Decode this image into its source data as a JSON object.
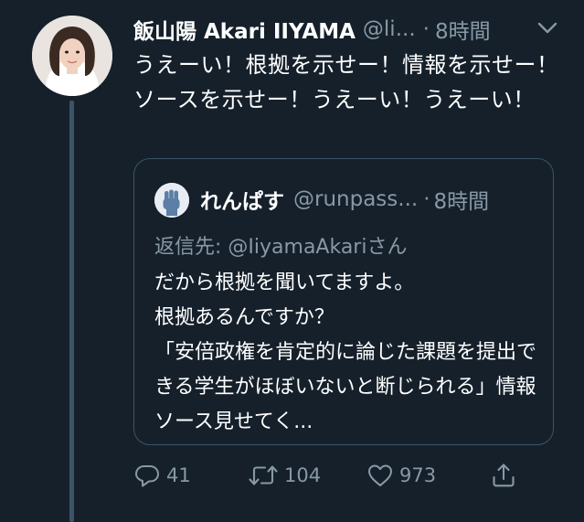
{
  "tweet": {
    "display_name": "飯山陽 Akari IIYAMA",
    "handle": "@li...",
    "separator": "·",
    "time": "8時間",
    "text": "うえーい！根拠を示せー！情報を示せー！ソースを示せー！うえーい！うえーい！",
    "icons": {
      "avatar": "avatar",
      "more": "chevron-down-icon"
    }
  },
  "quoted_tweet": {
    "display_name": "れんぱす",
    "handle": "@runpass...",
    "separator": "·",
    "time": "8時間",
    "reply_prefix": "返信先: ",
    "reply_handle": "@IiyamaAkari",
    "reply_suffix": "さん",
    "text": "だから根拠を聞いてますよ。\n根拠あるんですか？\n「安倍政権を肯定的に論じた課題を提出できる学生がほぼいないと断じられる」情報ソース見せてく..."
  },
  "actions": {
    "reply_count": "41",
    "retweet_count": "104",
    "like_count": "973",
    "icons": [
      "reply-icon",
      "retweet-icon",
      "like-icon",
      "share-icon"
    ]
  },
  "colors": {
    "background": "#15202b",
    "text": "#ffffff",
    "muted": "#8899a6",
    "border": "#3d5466"
  }
}
